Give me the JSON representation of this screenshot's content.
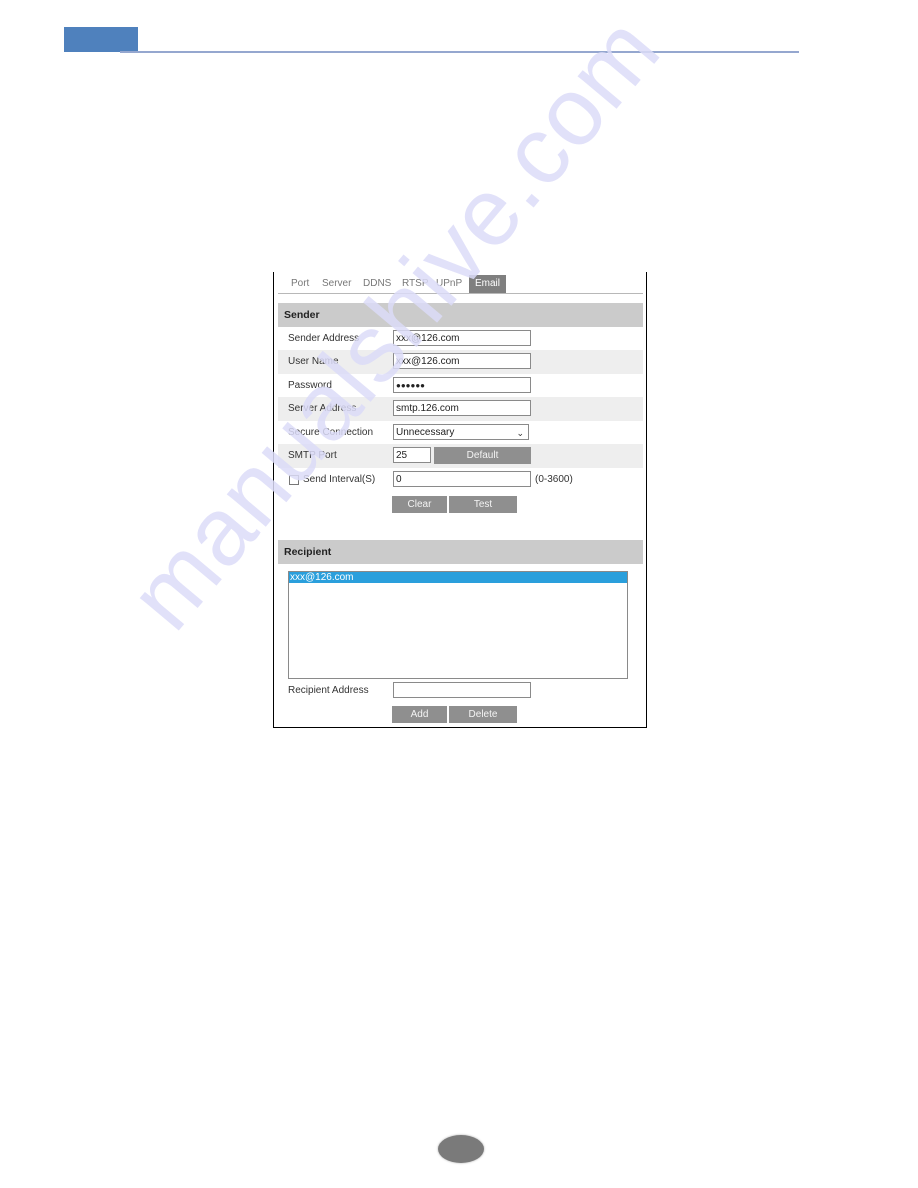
{
  "page": {
    "header_accent_color": "#4f81bd",
    "header_rule_color": "#95a7cf",
    "watermark": "manualshive.com"
  },
  "tabs": [
    {
      "label": "Port",
      "active": false
    },
    {
      "label": "Server",
      "active": false
    },
    {
      "label": "DDNS",
      "active": false
    },
    {
      "label": "RTSP",
      "active": false
    },
    {
      "label": "UPnP",
      "active": false
    },
    {
      "label": "Email",
      "active": true
    }
  ],
  "sender": {
    "title": "Sender",
    "sender_address": {
      "label": "Sender Address",
      "value": "xxx@126.com"
    },
    "user_name": {
      "label": "User Name",
      "value": "xxx@126.com"
    },
    "password": {
      "label": "Password",
      "value": "●●●●●●"
    },
    "server_address": {
      "label": "Server Address",
      "value": "smtp.126.com"
    },
    "secure_connection": {
      "label": "Secure Connection",
      "value": "Unnecessary"
    },
    "smtp_port": {
      "label": "SMTP Port",
      "value": "25",
      "default_button": "Default"
    },
    "send_interval": {
      "label": "Send Interval(S)",
      "checked": false,
      "value": "0",
      "range_hint": "(0-3600)"
    },
    "clear_button": "Clear",
    "test_button": "Test"
  },
  "recipient": {
    "title": "Recipient",
    "list": [
      "xxx@126.com"
    ],
    "selected_index": 0,
    "address": {
      "label": "Recipient Address",
      "value": ""
    },
    "add_button": "Add",
    "delete_button": "Delete"
  },
  "colors": {
    "tab_active_bg": "#7f7f7f",
    "section_header_bg": "#cbcbcb",
    "button_bg": "#8f8f8f",
    "selection_blue": "#2a9fdc"
  }
}
